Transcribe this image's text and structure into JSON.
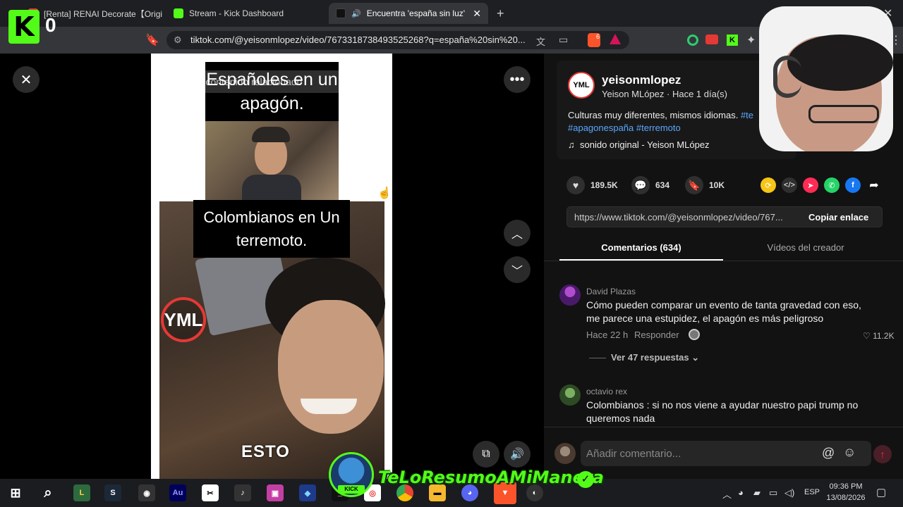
{
  "browser": {
    "tabs": [
      {
        "label": "[Renta] RENAI Decorate【Original Cl",
        "favicon_color": "#e53935"
      },
      {
        "label": "Stream - Kick Dashboard",
        "favicon_color": "#53fc18"
      },
      {
        "label": "Encuentra 'españa sin luz' en",
        "favicon_color": "#111111"
      }
    ],
    "url": "tiktok.com/@yeisonmlopez/video/7673318738493525268?q=españa%20sin%20...",
    "brave_badge": "6",
    "kick_overlay_count": "0"
  },
  "video": {
    "search_placeholder": "Buscar contenido relacionado",
    "caption_top": "Españoles en un apagón.",
    "caption_mid": "Colombianos en Un terremoto.",
    "caption_bottom": "ESTO",
    "watermark": "YML"
  },
  "creator": {
    "username": "yeisonmlopez",
    "display_line": "Yeison MLópez · Hace 1 día(s)",
    "avatar_text": "YML",
    "description": "Culturas muy diferentes, mismos idiomas.",
    "hashtag_partial": "#te",
    "hashtags": "#apagonespaña #terremoto",
    "sound": "sonido original - Yeison MLópez"
  },
  "stats": {
    "likes": "189.5K",
    "comments": "634",
    "saves": "10K"
  },
  "share_link": {
    "url": "https://www.tiktok.com/@yeisonmlopez/video/767...",
    "copy_label": "Copiar enlace"
  },
  "tabs": {
    "comments": "Comentarios (634)",
    "creator_videos": "Vídeos del creador"
  },
  "comments": [
    {
      "author": "David Plazas",
      "text": "Cómo pueden comparar un evento de tanta gravedad con eso, me parece una estupidez, el apagón es más peligroso",
      "time": "Hace 22 h",
      "reply_label": "Responder",
      "likes": "11.2K",
      "replies_label": "Ver 47 respuestas"
    },
    {
      "author": "octavio rex",
      "text": "Colombianos : si no nos viene a ayudar nuestro papi trump no queremos nada"
    }
  ],
  "comment_input": {
    "placeholder": "Añadir comentario..."
  },
  "overlay": {
    "channel_name": "TeLoResumoAMiManera",
    "kick_label": "KICK"
  },
  "taskbar": {
    "language": "ESP",
    "time": "09:36 PM",
    "date": "13/08/2026"
  },
  "colors": {
    "kick_green": "#53fc18",
    "accent_red": "#fe2c55",
    "hashtag_blue": "#5aa7ff"
  }
}
